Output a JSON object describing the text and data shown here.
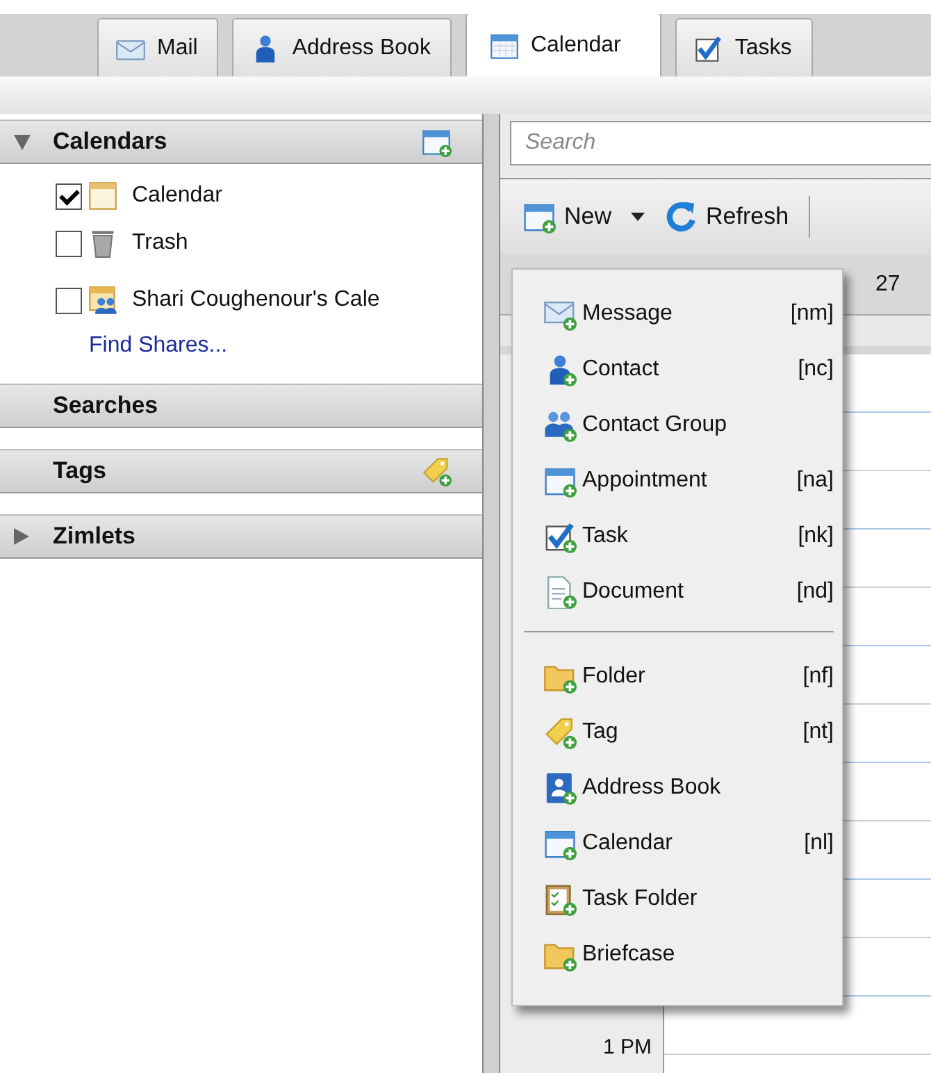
{
  "app_tabs": [
    {
      "label": "Mail",
      "kind": "mail",
      "selected": false
    },
    {
      "label": "Address Book",
      "kind": "contact",
      "selected": false
    },
    {
      "label": "Calendar",
      "kind": "calendar",
      "selected": true
    },
    {
      "label": "Tasks",
      "kind": "task",
      "selected": false
    }
  ],
  "sidebar": {
    "sections": [
      {
        "title": "Calendars",
        "kind": "calendar",
        "expanded": true,
        "items": [
          {
            "label": "Calendar",
            "kind": "calendar",
            "checked": true
          },
          {
            "label": "Trash",
            "kind": "trash",
            "checked": false
          },
          {
            "label": "Shari Coughenour's Cale",
            "kind": "shared",
            "checked": false
          }
        ],
        "link": "Find Shares..."
      },
      {
        "title": "Searches",
        "kind": "plain"
      },
      {
        "title": "Tags",
        "kind": "tag"
      },
      {
        "title": "Zimlets",
        "kind": "plain",
        "expanded": false
      }
    ]
  },
  "search": {
    "placeholder": "Search"
  },
  "toolbar": {
    "buttons": [
      {
        "label": "New",
        "kind": "new"
      },
      {
        "label": "Refresh",
        "kind": "refresh"
      }
    ]
  },
  "calendar": {
    "day_header": "27",
    "time_label": "1 PM"
  },
  "new_menu": {
    "groups": [
      [
        {
          "label": "Message",
          "shortcut": "[nm]",
          "kind": "message"
        },
        {
          "label": "Contact",
          "shortcut": "[nc]",
          "kind": "contact"
        },
        {
          "label": "Contact Group",
          "kind": "group"
        },
        {
          "label": "Appointment",
          "shortcut": "[na]",
          "kind": "calendar"
        },
        {
          "label": "Task",
          "shortcut": "[nk]",
          "kind": "task"
        },
        {
          "label": "Document",
          "shortcut": "[nd]",
          "kind": "document"
        }
      ],
      [
        {
          "label": "Folder",
          "shortcut": "[nf]",
          "kind": "folder"
        },
        {
          "label": "Tag",
          "shortcut": "[nt]",
          "kind": "tag"
        },
        {
          "label": "Address Book",
          "kind": "addressbook"
        },
        {
          "label": "Calendar",
          "shortcut": "[nl]",
          "kind": "calendar"
        },
        {
          "label": "Task Folder",
          "kind": "taskfolder"
        },
        {
          "label": "Briefcase",
          "kind": "folder"
        }
      ]
    ]
  }
}
